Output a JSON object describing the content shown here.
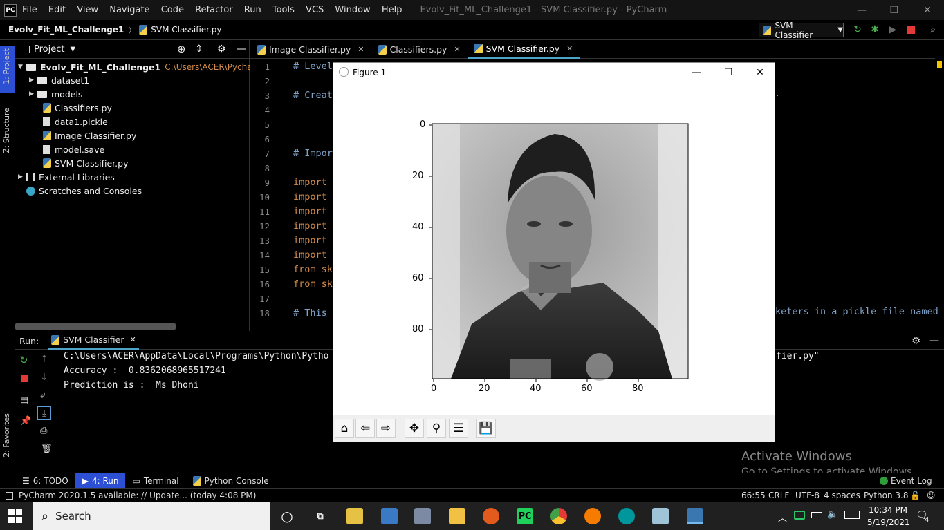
{
  "window": {
    "title": "Evolv_Fit_ML_Challenge1 - SVM Classifier.py - PyCharm",
    "logo": "PC",
    "menu": [
      "File",
      "Edit",
      "View",
      "Navigate",
      "Code",
      "Refactor",
      "Run",
      "Tools",
      "VCS",
      "Window",
      "Help"
    ]
  },
  "navbar": {
    "project": "Evolv_Fit_ML_Challenge1",
    "file": "SVM Classifier.py",
    "run_config": "SVM Classifier"
  },
  "stripes": {
    "project": "1: Project",
    "structure": "Z: Structure",
    "favorites": "2: Favorites"
  },
  "project_panel": {
    "title": "Project",
    "root": "Evolv_Fit_ML_Challenge1",
    "root_path": "C:\\Users\\ACER\\PycharmProje",
    "items": [
      {
        "label": "dataset1",
        "kind": "folder"
      },
      {
        "label": "models",
        "kind": "folder"
      },
      {
        "label": "Classifiers.py",
        "kind": "py"
      },
      {
        "label": "data1.pickle",
        "kind": "file"
      },
      {
        "label": "Image Classifier.py",
        "kind": "py"
      },
      {
        "label": "model.save",
        "kind": "file"
      },
      {
        "label": "SVM Classifier.py",
        "kind": "py"
      }
    ],
    "external": "External Libraries",
    "scratches": "Scratches and Consoles"
  },
  "editor": {
    "tabs": [
      "Image Classifier.py",
      "Classifiers.py",
      "SVM Classifier.py"
    ],
    "line_numbers": [
      "1",
      "2",
      "3",
      "4",
      "5",
      "6",
      "7",
      "8",
      "9",
      "10",
      "11",
      "12",
      "13",
      "14",
      "15",
      "16",
      "17",
      "18"
    ],
    "lines": [
      {
        "text": "# Level",
        "cls": "cmt"
      },
      {
        "text": "",
        "cls": ""
      },
      {
        "text": "# Creat",
        "cls": "cmt"
      },
      {
        "text": "",
        "cls": ""
      },
      {
        "text": "",
        "cls": ""
      },
      {
        "text": "",
        "cls": ""
      },
      {
        "text": "# Impor",
        "cls": "cmt"
      },
      {
        "text": "",
        "cls": ""
      },
      {
        "text": "import ",
        "cls": "kw"
      },
      {
        "text": "import ",
        "cls": "kw"
      },
      {
        "text": "import ",
        "cls": "kw"
      },
      {
        "text": "import ",
        "cls": "kw"
      },
      {
        "text": "import ",
        "cls": "kw"
      },
      {
        "text": "import ",
        "cls": "kw"
      },
      {
        "text": "from sk",
        "cls": "kw"
      },
      {
        "text": "from sk",
        "cls": "kw"
      },
      {
        "text": "",
        "cls": ""
      },
      {
        "text": "# This ",
        "cls": "cmt"
      }
    ],
    "right_fragment_3": ".",
    "right_fragment_18": "keters in a pickle file named"
  },
  "run_panel": {
    "label": "Run:",
    "tab": "SVM Classifier",
    "console": [
      "C:\\Users\\ACER\\AppData\\Local\\Programs\\Python\\Pytho",
      "Accuracy :  0.8362068965517241",
      "Prediction is :  Ms Dhoni"
    ],
    "console_right": "fier.py\""
  },
  "figure": {
    "title": "Figure 1",
    "y_ticks": [
      "0",
      "20",
      "40",
      "60",
      "80"
    ],
    "x_ticks": [
      "0",
      "20",
      "40",
      "60",
      "80"
    ],
    "image_alt": "grayscale portrait (low resolution)"
  },
  "tool_windows": [
    {
      "label": "6: TODO",
      "active": false
    },
    {
      "label": "4: Run",
      "active": true
    },
    {
      "label": "Terminal",
      "active": false
    },
    {
      "label": "Python Console",
      "active": false
    }
  ],
  "event_log": "Event Log",
  "activate": {
    "title": "Activate Windows",
    "subtitle": "Go to Settings to activate Windows."
  },
  "status": {
    "message": "PyCharm 2020.1.5 available: // Update... (today 4:08 PM)",
    "position": "66:55",
    "line_sep": "CRLF",
    "encoding": "UTF-8",
    "indent": "4 spaces",
    "interpreter": "Python 3.8"
  },
  "taskbar": {
    "search": "Search",
    "time": "10:34 PM",
    "date": "5/19/2021",
    "notifications": "4"
  }
}
